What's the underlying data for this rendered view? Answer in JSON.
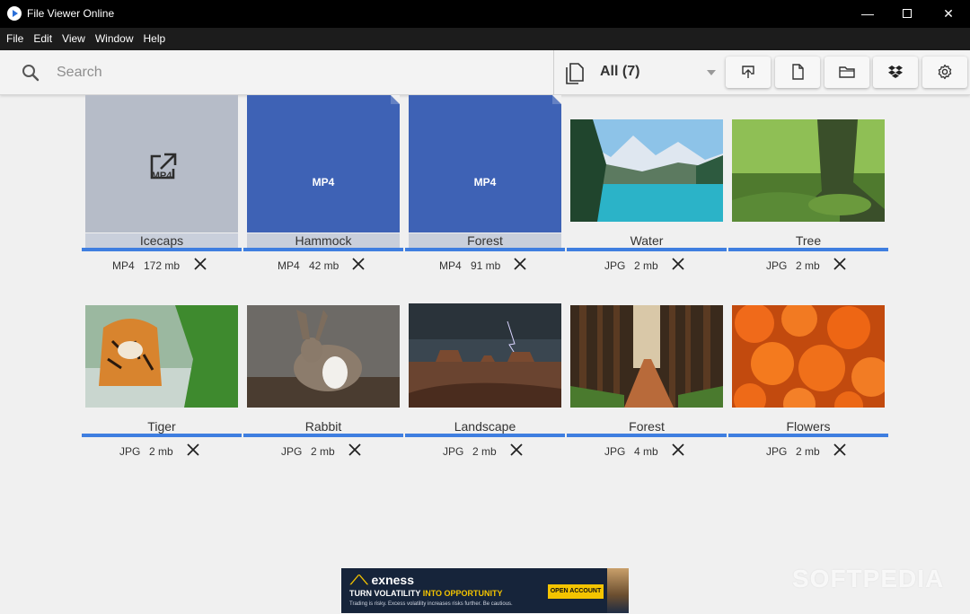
{
  "window": {
    "title": "File Viewer Online",
    "minimize": "—",
    "close": "✕"
  },
  "menu": [
    "File",
    "Edit",
    "View",
    "Window",
    "Help"
  ],
  "toolbar": {
    "search_placeholder": "Search",
    "filter_label": "All (7)",
    "buttons": [
      "upload-icon",
      "file-icon",
      "folder-icon",
      "dropbox-icon",
      "gear-icon"
    ]
  },
  "files": [
    {
      "name": "Icecaps",
      "type": "MP4",
      "size": "172 mb",
      "thumb": "open-external-icon",
      "thumb_text": "MP4"
    },
    {
      "name": "Hammock",
      "type": "MP4",
      "size": "42 mb",
      "thumb_text": "MP4"
    },
    {
      "name": "Forest",
      "type": "MP4",
      "size": "91 mb",
      "thumb_text": "MP4"
    },
    {
      "name": "Water",
      "type": "JPG",
      "size": "2 mb"
    },
    {
      "name": "Tree",
      "type": "JPG",
      "size": "2 mb"
    },
    {
      "name": "Tiger",
      "type": "JPG",
      "size": "2 mb"
    },
    {
      "name": "Rabbit",
      "type": "JPG",
      "size": "2 mb"
    },
    {
      "name": "Landscape",
      "type": "JPG",
      "size": "2 mb"
    },
    {
      "name": "Forest",
      "type": "JPG",
      "size": "4 mb"
    },
    {
      "name": "Flowers",
      "type": "JPG",
      "size": "2 mb"
    }
  ],
  "ad": {
    "brand": "exness",
    "tagline_a": "TURN VOLATILITY",
    "tagline_b": "INTO OPPORTUNITY",
    "disclaimer": "Trading is risky. Excess volatility increases risks further. Be cautious.",
    "cta": "OPEN ACCOUNT"
  },
  "watermark": "SOFTPEDIA",
  "colors": {
    "accent": "#3f7ee0",
    "video_thumb": "#3e62b5",
    "gray_thumb": "#b6bcc8",
    "titlebar": "#000000"
  }
}
